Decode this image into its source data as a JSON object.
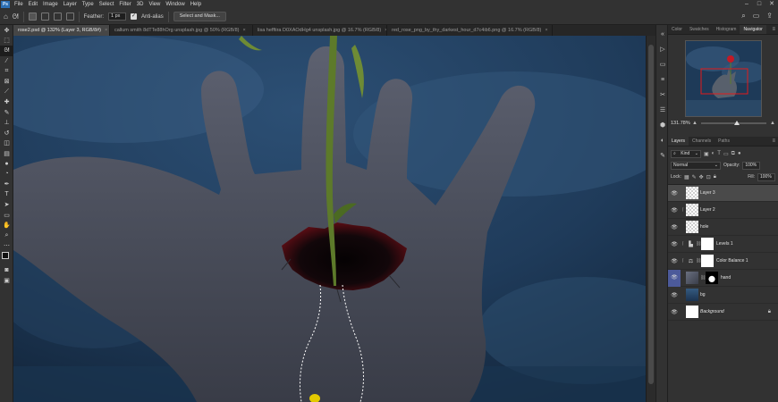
{
  "menu": {
    "app_logo": "Ps",
    "items": [
      "File",
      "Edit",
      "Image",
      "Layer",
      "Type",
      "Select",
      "Filter",
      "3D",
      "View",
      "Window",
      "Help"
    ],
    "window_controls": [
      "–",
      "□",
      "✕"
    ]
  },
  "options": {
    "feather_label": "Feather:",
    "feather_value": "1 px",
    "antialias_label": "Anti-alias",
    "antialias_checked": true,
    "select_mask_label": "Select and Mask..."
  },
  "tabs": [
    {
      "label": "rose2.psd @ 132% (Layer 3, RGB/8#)",
      "active": true
    },
    {
      "label": "callum smith 8dTTe88hOrg unsplash.jpg @ 50% (RGB/8)",
      "active": false
    },
    {
      "label": "lisa hefftira D0XAOdHg4 unsplash.jpg @ 16.7% (RGB/8)",
      "active": false
    },
    {
      "label": "red_rose_png_by_thy_darkest_hour_d7c4ib6.png @ 16.7% (RGB/8)",
      "active": false
    }
  ],
  "navigator": {
    "tabs": [
      "Color",
      "Swatches",
      "Histogram",
      "Navigator"
    ],
    "active_tab": "Navigator",
    "zoom_text": "131.78%",
    "zoom_fraction": 0.55
  },
  "layers_panel": {
    "tabs": [
      "Layers",
      "Channels",
      "Paths"
    ],
    "active_tab": "Layers",
    "filter_kind": "Kind",
    "blend_mode": "Normal",
    "opacity_label": "Opacity:",
    "opacity_value": "100%",
    "lock_label": "Lock:",
    "fill_label": "Fill:",
    "fill_value": "100%",
    "layers": [
      {
        "name": "Layer 3",
        "selected": true,
        "thumb": "checker",
        "has_mask": false,
        "linked": false
      },
      {
        "name": "Layer 2",
        "selected": false,
        "thumb": "checker",
        "has_mask": false,
        "linked": true
      },
      {
        "name": "hole",
        "selected": false,
        "thumb": "checker",
        "has_mask": false,
        "linked": false
      },
      {
        "name": "Levels 1",
        "selected": false,
        "thumb": "levels",
        "has_mask": true,
        "linked": true
      },
      {
        "name": "Color Balance 1",
        "selected": false,
        "thumb": "balance",
        "has_mask": true,
        "linked": true
      },
      {
        "name": "hand",
        "selected": false,
        "thumb": "hand",
        "has_mask": true,
        "linked": false,
        "highlight": true
      },
      {
        "name": "bg",
        "selected": false,
        "thumb": "sky",
        "has_mask": false,
        "linked": false
      },
      {
        "name": "Background",
        "selected": false,
        "thumb": "white",
        "has_mask": false,
        "linked": false,
        "locked": true,
        "italic": true
      }
    ]
  },
  "colors": {
    "accent": "#2d6fb3",
    "foreground_swatch": "#111111",
    "background_swatch": "#c0001a"
  }
}
